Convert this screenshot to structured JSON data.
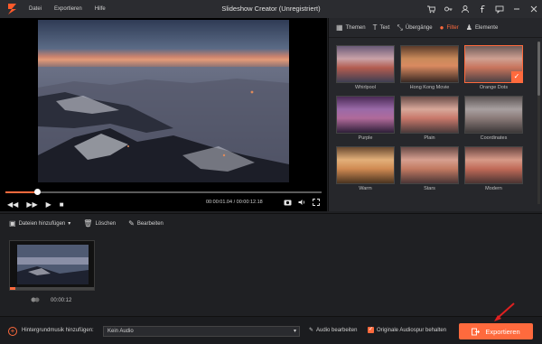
{
  "app": {
    "title": "Slideshow Creator (Unregistriert)"
  },
  "menu": [
    "Datei",
    "Exportieren",
    "Hilfe"
  ],
  "window_icons": [
    "cart-icon",
    "key-icon",
    "user-icon",
    "facebook-icon",
    "feedback-icon",
    "minimize-icon",
    "close-icon"
  ],
  "player": {
    "time_current": "00:00:01.04",
    "time_sep": "/",
    "time_total": "00:00:12.18",
    "progress": 0.1
  },
  "tabs": [
    {
      "label": "Themen",
      "icon": "themes-icon"
    },
    {
      "label": "Text",
      "icon": "text-icon"
    },
    {
      "label": "Übergänge",
      "icon": "transitions-icon"
    },
    {
      "label": "Filter",
      "icon": "filter-icon",
      "active": true
    },
    {
      "label": "Elemente",
      "icon": "elements-icon"
    }
  ],
  "filters": [
    {
      "label": "Whirlpool"
    },
    {
      "label": "Hong Kong Movie"
    },
    {
      "label": "Orange Dots",
      "selected": true
    },
    {
      "label": "Purple"
    },
    {
      "label": "Plain"
    },
    {
      "label": "Coordinates"
    },
    {
      "label": "Warm"
    },
    {
      "label": "Stars"
    },
    {
      "label": "Modern"
    }
  ],
  "toolbar": {
    "add_files": "Dateien hinzufügen",
    "add_files_caret": "▾",
    "delete": "Löschen",
    "edit": "Bearbeiten"
  },
  "timeline": {
    "clip_duration": "00:00:12"
  },
  "bottom": {
    "bgm_label": "Hintergrundmusik hinzufügen:",
    "audio_select": "Kein Audio",
    "audio_edit": "Audio bearbeiten",
    "keep_original": "Originale Audiospur behalten",
    "export": "Exportieren"
  },
  "colors": {
    "accent": "#ff6a3d",
    "bg": "#1f2023",
    "panel": "#26272b"
  }
}
